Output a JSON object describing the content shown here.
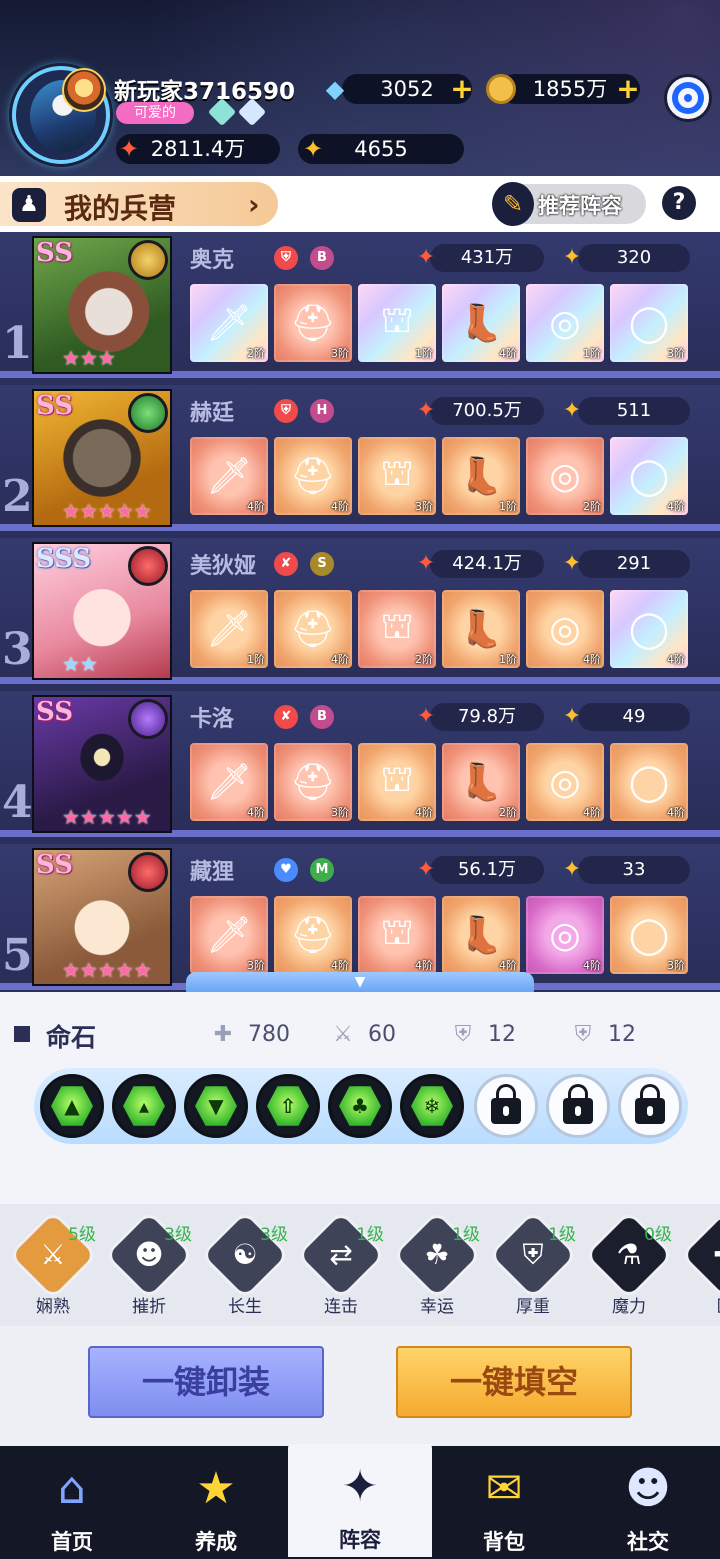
{
  "player": {
    "name": "新玩家3716590",
    "title_badge": "可爱的",
    "diamonds": "3052",
    "gold": "1855万",
    "power": "2811.4万",
    "stars": "4655"
  },
  "barracks": {
    "title": "我的兵营",
    "recommend_label": "推荐阵容",
    "help": "?"
  },
  "heroes": [
    {
      "index": "1",
      "rank": "SS",
      "name": "奥克",
      "tag": "B",
      "power": "431万",
      "star_power": "320",
      "equipment": [
        {
          "icon": "sword",
          "tier": "2阶",
          "quality": "rainbow"
        },
        {
          "icon": "chest-armor",
          "tier": "3阶",
          "quality": "salmon"
        },
        {
          "icon": "helmet",
          "tier": "1阶",
          "quality": "rainbow"
        },
        {
          "icon": "boot",
          "tier": "4阶",
          "quality": "rainbow"
        },
        {
          "icon": "amulet",
          "tier": "1阶",
          "quality": "rainbow"
        },
        {
          "icon": "ring",
          "tier": "3阶",
          "quality": "rainbow"
        }
      ]
    },
    {
      "index": "2",
      "rank": "SS",
      "name": "赫廷",
      "tag": "H",
      "power": "700.5万",
      "star_power": "511",
      "equipment": [
        {
          "icon": "sword",
          "tier": "4阶",
          "quality": "salmon"
        },
        {
          "icon": "chest-armor",
          "tier": "4阶",
          "quality": "orange"
        },
        {
          "icon": "helmet",
          "tier": "3阶",
          "quality": "orange"
        },
        {
          "icon": "boot",
          "tier": "1阶",
          "quality": "orange"
        },
        {
          "icon": "amulet",
          "tier": "2阶",
          "quality": "salmon"
        },
        {
          "icon": "ring",
          "tier": "4阶",
          "quality": "rainbow"
        }
      ]
    },
    {
      "index": "3",
      "rank": "SSS",
      "name": "美狄娅",
      "tag": "S",
      "power": "424.1万",
      "star_power": "291",
      "equipment": [
        {
          "icon": "sword",
          "tier": "1阶",
          "quality": "orange"
        },
        {
          "icon": "chest-armor",
          "tier": "4阶",
          "quality": "orange"
        },
        {
          "icon": "helmet",
          "tier": "2阶",
          "quality": "salmon"
        },
        {
          "icon": "boot",
          "tier": "1阶",
          "quality": "orange"
        },
        {
          "icon": "amulet",
          "tier": "4阶",
          "quality": "orange"
        },
        {
          "icon": "ring",
          "tier": "4阶",
          "quality": "rainbow"
        }
      ]
    },
    {
      "index": "4",
      "rank": "SS",
      "name": "卡洛",
      "tag": "B",
      "power": "79.8万",
      "star_power": "49",
      "equipment": [
        {
          "icon": "sword",
          "tier": "4阶",
          "quality": "salmon"
        },
        {
          "icon": "chest-armor",
          "tier": "3阶",
          "quality": "salmon"
        },
        {
          "icon": "helmet",
          "tier": "4阶",
          "quality": "orange"
        },
        {
          "icon": "boot",
          "tier": "2阶",
          "quality": "salmon"
        },
        {
          "icon": "amulet",
          "tier": "4阶",
          "quality": "orange"
        },
        {
          "icon": "ring",
          "tier": "4阶",
          "quality": "orange"
        }
      ]
    },
    {
      "index": "5",
      "rank": "SS",
      "name": "藏狸",
      "tag": "M",
      "power": "56.1万",
      "star_power": "33",
      "equipment": [
        {
          "icon": "sword",
          "tier": "3阶",
          "quality": "salmon"
        },
        {
          "icon": "chest-armor",
          "tier": "4阶",
          "quality": "orange"
        },
        {
          "icon": "helmet",
          "tier": "4阶",
          "quality": "salmon"
        },
        {
          "icon": "boot",
          "tier": "4阶",
          "quality": "orange"
        },
        {
          "icon": "amulet",
          "tier": "4阶",
          "quality": "pink"
        },
        {
          "icon": "ring",
          "tier": "3阶",
          "quality": "orange"
        }
      ]
    }
  ],
  "life_stones": {
    "title": "命石",
    "hp": "780",
    "attack": "60",
    "defense": "12",
    "resist": "12",
    "unlocked_count": 6,
    "locked_count": 3
  },
  "traits": [
    {
      "name": "娴熟",
      "level": "5级"
    },
    {
      "name": "摧折",
      "level": "3级"
    },
    {
      "name": "长生",
      "level": "3级"
    },
    {
      "name": "连击",
      "level": "1级"
    },
    {
      "name": "幸运",
      "level": "1级"
    },
    {
      "name": "厚重",
      "level": "1级"
    },
    {
      "name": "魔力",
      "level": "0级"
    },
    {
      "name": "医",
      "level": ""
    }
  ],
  "actions": {
    "unequip_all": "一键卸装",
    "auto_fill": "一键填空"
  },
  "nav": [
    {
      "label": "首页",
      "icon": "home-icon"
    },
    {
      "label": "养成",
      "icon": "upgrade-icon"
    },
    {
      "label": "阵容",
      "icon": "lineup-icon"
    },
    {
      "label": "背包",
      "icon": "bag-icon"
    },
    {
      "label": "社交",
      "icon": "social-icon"
    }
  ],
  "colors": {
    "accent_pink": "#f46bc3",
    "nav_bg": "#141826",
    "row_divider": "#6a70c9"
  }
}
